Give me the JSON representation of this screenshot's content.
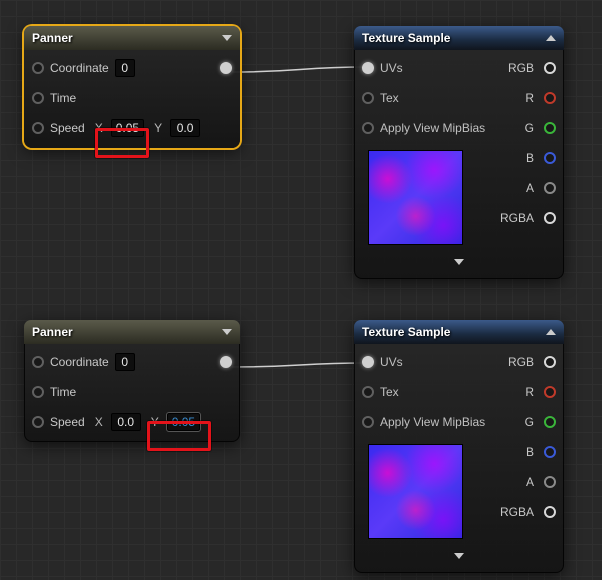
{
  "panner1": {
    "title": "Panner",
    "coordinate_label": "Coordinate",
    "coordinate_value": "0",
    "time_label": "Time",
    "speed_label": "Speed",
    "x_label": "X",
    "x_value": "0.05",
    "y_label": "Y",
    "y_value": "0.0"
  },
  "panner2": {
    "title": "Panner",
    "coordinate_label": "Coordinate",
    "coordinate_value": "0",
    "time_label": "Time",
    "speed_label": "Speed",
    "x_label": "X",
    "x_value": "0.0",
    "y_label": "Y",
    "y_value": "0.05"
  },
  "texsample1": {
    "title": "Texture Sample",
    "uvs": "UVs",
    "tex": "Tex",
    "mip": "Apply View MipBias",
    "out_rgb": "RGB",
    "out_r": "R",
    "out_g": "G",
    "out_b": "B",
    "out_a": "A",
    "out_rgba": "RGBA"
  },
  "texsample2": {
    "title": "Texture Sample",
    "uvs": "UVs",
    "tex": "Tex",
    "mip": "Apply View MipBias",
    "out_rgb": "RGB",
    "out_r": "R",
    "out_g": "G",
    "out_b": "B",
    "out_a": "A",
    "out_rgba": "RGBA"
  }
}
